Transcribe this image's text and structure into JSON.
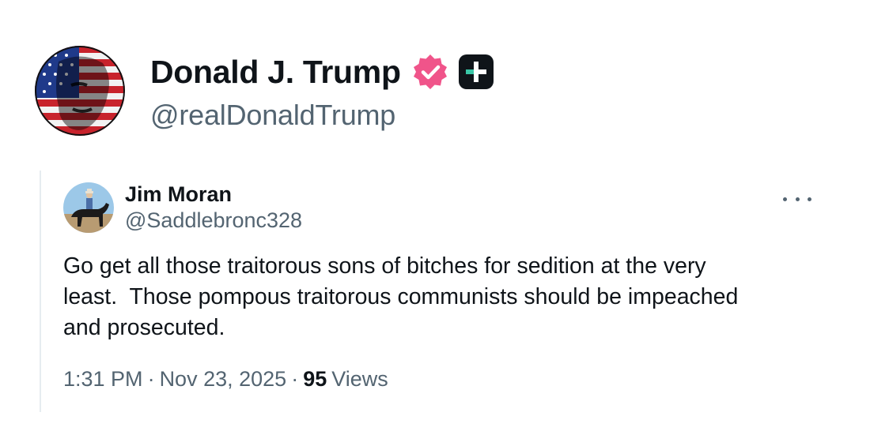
{
  "author": {
    "display_name": "Donald J. Trump",
    "handle": "@realDonaldTrump",
    "verified_badge_icon": "verified-badge-icon",
    "verified_badge_color": "#f0548a",
    "affiliate_badge_icon": "plus-badge-icon"
  },
  "quoted_post": {
    "author_name": "Jim Moran",
    "author_handle": "@Saddlebronc328",
    "text": "Go get all those traitorous sons of bitches for sedition at the very\nleast.  Those pompous traitorous communists should be impeached\nand prosecuted.",
    "time": "1:31 PM",
    "separator": "·",
    "date": "Nov 23, 2025",
    "views_count": "95",
    "views_label": "Views",
    "more_icon": "more-options-icon"
  },
  "colors": {
    "text_primary": "#0f1419",
    "text_secondary": "#536471",
    "divider": "#e6ecf0"
  }
}
